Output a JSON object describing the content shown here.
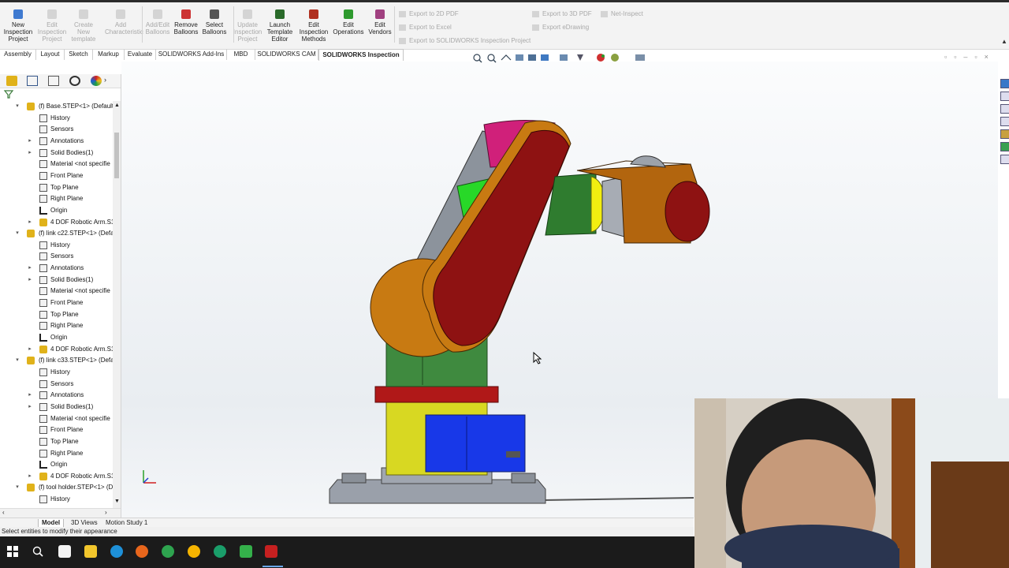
{
  "ribbon": {
    "buttons": [
      {
        "label": "New Inspection Project",
        "enabled": true
      },
      {
        "label": "Edit Inspection Project",
        "enabled": false
      },
      {
        "label": "Create New template",
        "enabled": false
      },
      {
        "label": "Add Characteristic",
        "enabled": false
      },
      {
        "label": "Add/Edit Balloons",
        "enabled": false
      },
      {
        "label": "Remove Balloons",
        "enabled": true
      },
      {
        "label": "Select Balloons",
        "enabled": true
      },
      {
        "label": "Update Inspection Project",
        "enabled": false
      },
      {
        "label": "Launch Template Editor",
        "enabled": true
      },
      {
        "label": "Edit Inspection Methods",
        "enabled": true
      },
      {
        "label": "Edit Operations",
        "enabled": true
      },
      {
        "label": "Edit Vendors",
        "enabled": true
      }
    ],
    "small_items": {
      "export_2d_pdf": "Export to 2D PDF",
      "export_excel": "Export to Excel",
      "export_sw_inspection": "Export to SOLIDWORKS Inspection Project",
      "export_3d_pdf": "Export to 3D PDF",
      "export_edrawing": "Export eDrawing",
      "net_inspect": "Net-Inspect"
    }
  },
  "tabs": [
    "Assembly",
    "Layout",
    "Sketch",
    "Markup",
    "Evaluate",
    "SOLIDWORKS Add-Ins",
    "MBD",
    "SOLIDWORKS CAM",
    "SOLIDWORKS Inspection"
  ],
  "active_tab": "SOLIDWORKS Inspection",
  "tree": [
    {
      "label": "(f) Base.STEP<1> (Default<",
      "level": 0,
      "kind": "part",
      "expander": "▾"
    },
    {
      "label": "History",
      "level": 1,
      "kind": "folder",
      "expander": ""
    },
    {
      "label": "Sensors",
      "level": 1,
      "kind": "folder",
      "expander": ""
    },
    {
      "label": "Annotations",
      "level": 1,
      "kind": "folder",
      "expander": "▸"
    },
    {
      "label": "Solid Bodies(1)",
      "level": 1,
      "kind": "folder",
      "expander": "▸"
    },
    {
      "label": "Material <not specifie",
      "level": 1,
      "kind": "folder",
      "expander": ""
    },
    {
      "label": "Front Plane",
      "level": 1,
      "kind": "plane",
      "expander": ""
    },
    {
      "label": "Top Plane",
      "level": 1,
      "kind": "plane",
      "expander": ""
    },
    {
      "label": "Right Plane",
      "level": 1,
      "kind": "plane",
      "expander": ""
    },
    {
      "label": "Origin",
      "level": 1,
      "kind": "origin",
      "expander": ""
    },
    {
      "label": "4 DOF Robotic Arm.S1",
      "level": 1,
      "kind": "part",
      "expander": "▸"
    },
    {
      "label": "(f) link c22.STEP<1> (Defa",
      "level": 0,
      "kind": "part",
      "expander": "▾"
    },
    {
      "label": "History",
      "level": 1,
      "kind": "folder",
      "expander": ""
    },
    {
      "label": "Sensors",
      "level": 1,
      "kind": "folder",
      "expander": ""
    },
    {
      "label": "Annotations",
      "level": 1,
      "kind": "folder",
      "expander": "▸"
    },
    {
      "label": "Solid Bodies(1)",
      "level": 1,
      "kind": "folder",
      "expander": "▸"
    },
    {
      "label": "Material <not specifie",
      "level": 1,
      "kind": "folder",
      "expander": ""
    },
    {
      "label": "Front Plane",
      "level": 1,
      "kind": "plane",
      "expander": ""
    },
    {
      "label": "Top Plane",
      "level": 1,
      "kind": "plane",
      "expander": ""
    },
    {
      "label": "Right Plane",
      "level": 1,
      "kind": "plane",
      "expander": ""
    },
    {
      "label": "Origin",
      "level": 1,
      "kind": "origin",
      "expander": ""
    },
    {
      "label": "4 DOF Robotic Arm.S1",
      "level": 1,
      "kind": "part",
      "expander": "▸"
    },
    {
      "label": "(f) link c33.STEP<1> (Defa",
      "level": 0,
      "kind": "part",
      "expander": "▾"
    },
    {
      "label": "History",
      "level": 1,
      "kind": "folder",
      "expander": ""
    },
    {
      "label": "Sensors",
      "level": 1,
      "kind": "folder",
      "expander": ""
    },
    {
      "label": "Annotations",
      "level": 1,
      "kind": "folder",
      "expander": "▸"
    },
    {
      "label": "Solid Bodies(1)",
      "level": 1,
      "kind": "folder",
      "expander": "▸"
    },
    {
      "label": "Material <not specifie",
      "level": 1,
      "kind": "folder",
      "expander": ""
    },
    {
      "label": "Front Plane",
      "level": 1,
      "kind": "plane",
      "expander": ""
    },
    {
      "label": "Top Plane",
      "level": 1,
      "kind": "plane",
      "expander": ""
    },
    {
      "label": "Right Plane",
      "level": 1,
      "kind": "plane",
      "expander": ""
    },
    {
      "label": "Origin",
      "level": 1,
      "kind": "origin",
      "expander": ""
    },
    {
      "label": "4 DOF Robotic Arm.S1",
      "level": 1,
      "kind": "part",
      "expander": "▸"
    },
    {
      "label": "(f) tool holder.STEP<1> (D",
      "level": 0,
      "kind": "part",
      "expander": "▾"
    },
    {
      "label": "History",
      "level": 1,
      "kind": "folder",
      "expander": ""
    }
  ],
  "bottom_tabs": [
    "Model",
    "3D Views",
    "Motion Study 1"
  ],
  "active_bottom_tab": "Model",
  "status": "Select entities to modify their appearance",
  "colors": {
    "accent": "#c00000",
    "link_red": "#8b1010",
    "link_orange": "#c87810",
    "green": "#2e7d32",
    "yellow": "#f2e600",
    "blue": "#1030e0",
    "magenta": "#d0206a"
  }
}
